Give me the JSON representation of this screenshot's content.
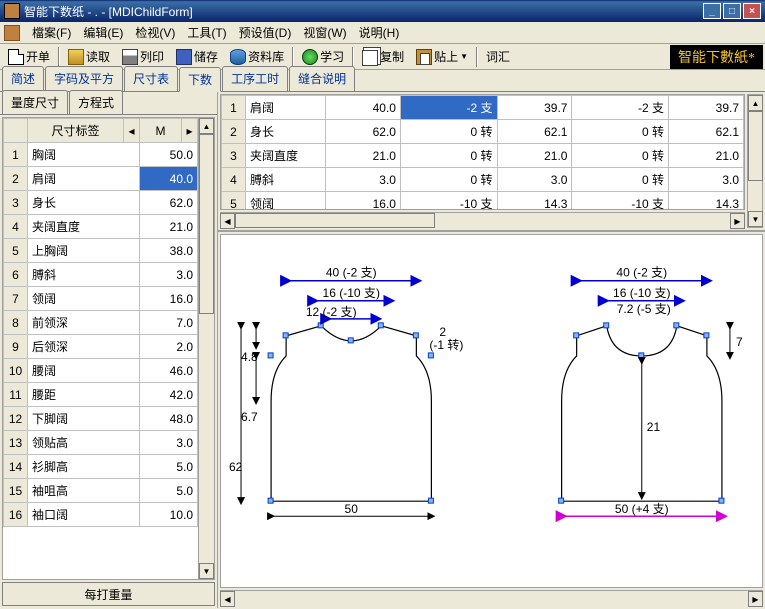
{
  "window": {
    "title": "智能下数纸 - . - [MDIChildForm]"
  },
  "menu": {
    "file": "檔案(F)",
    "edit": "编辑(E)",
    "view": "检视(V)",
    "tool": "工具(T)",
    "preset": "预设值(D)",
    "window": "视窗(W)",
    "help": "说明(H)"
  },
  "toolbar": {
    "open": "开单",
    "read": "读取",
    "print": "列印",
    "save": "储存",
    "data": "资料库",
    "study": "学习",
    "copy": "复制",
    "paste": "贴上",
    "vocab": "词汇"
  },
  "brand": "智能下數紙*",
  "maintabs": [
    "简述",
    "字码及平方",
    "尺寸表",
    "下数",
    "工序工时",
    "缝合说明"
  ],
  "activeTab": 3,
  "subtabs": [
    "量度尺寸",
    "方程式"
  ],
  "activeSubtab": 0,
  "leftHeader": {
    "c1": "尺寸标签",
    "c2": "M"
  },
  "dims": [
    {
      "n": 1,
      "label": "胸阔",
      "val": "50.0"
    },
    {
      "n": 2,
      "label": "肩阔",
      "val": "40.0",
      "sel": true
    },
    {
      "n": 3,
      "label": "身长",
      "val": "62.0"
    },
    {
      "n": 4,
      "label": "夹阔直度",
      "val": "21.0"
    },
    {
      "n": 5,
      "label": "上胸阔",
      "val": "38.0"
    },
    {
      "n": 6,
      "label": "膊斜",
      "val": "3.0"
    },
    {
      "n": 7,
      "label": "领阔",
      "val": "16.0"
    },
    {
      "n": 8,
      "label": "前领深",
      "val": "7.0"
    },
    {
      "n": 9,
      "label": "后领深",
      "val": "2.0"
    },
    {
      "n": 10,
      "label": "腰阔",
      "val": "46.0"
    },
    {
      "n": 11,
      "label": "腰距",
      "val": "42.0"
    },
    {
      "n": 12,
      "label": "下脚阔",
      "val": "48.0"
    },
    {
      "n": 13,
      "label": "领贴高",
      "val": "3.0"
    },
    {
      "n": 14,
      "label": "衫脚高",
      "val": "5.0"
    },
    {
      "n": 15,
      "label": "袖咀高",
      "val": "5.0"
    },
    {
      "n": 16,
      "label": "袖口阔",
      "val": "10.0"
    }
  ],
  "footerBtn": "每打重量",
  "topgrid": {
    "rows": [
      {
        "n": 1,
        "lbl": "肩阔",
        "v1": "40.0",
        "v2": "-2 支",
        "v3": "39.7",
        "v4": "-2 支",
        "v5": "39.7",
        "sel": true
      },
      {
        "n": 2,
        "lbl": "身长",
        "v1": "62.0",
        "v2": "0 转",
        "v3": "62.1",
        "v4": "0 转",
        "v5": "62.1"
      },
      {
        "n": 3,
        "lbl": "夹阔直度",
        "v1": "21.0",
        "v2": "0 转",
        "v3": "21.0",
        "v4": "0 转",
        "v5": "21.0"
      },
      {
        "n": 4,
        "lbl": "膊斜",
        "v1": "3.0",
        "v2": "0 转",
        "v3": "3.0",
        "v4": "0 转",
        "v5": "3.0"
      },
      {
        "n": 5,
        "lbl": "领阔",
        "v1": "16.0",
        "v2": "-10 支",
        "v3": "14.3",
        "v4": "-10 支",
        "v5": "14.3"
      }
    ]
  },
  "chart_data": {
    "type": "diagram",
    "front": {
      "shoulder": "40 (-2 支)",
      "neck": "16 (-10 支)",
      "neckw": "12 (-2 支)",
      "neckd": "2 (-1 转)",
      "shldr": "4.8",
      "arm": "6.7",
      "body": "62",
      "width": "50"
    },
    "back": {
      "shoulder": "40 (-2 支)",
      "neck": "16 (-10 支)",
      "neckd": "7.2 (-5 支)",
      "neckd2": "7",
      "arm": "21",
      "width": "50 (+4 支)"
    }
  }
}
